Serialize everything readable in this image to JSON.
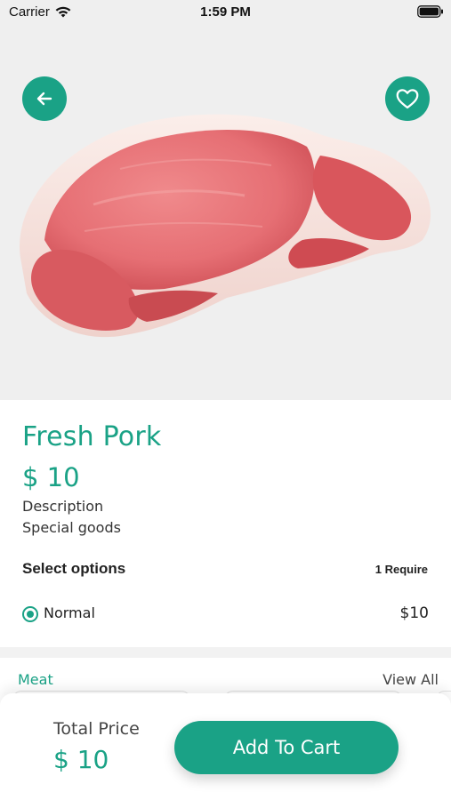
{
  "status_bar": {
    "carrier": "Carrier",
    "time": "1:59 PM",
    "icons": [
      "wifi-icon",
      "battery-icon"
    ]
  },
  "hero": {
    "image": "pork-chop-image",
    "back_icon": "arrow-left-icon",
    "favorite_icon": "heart-outline-icon"
  },
  "product": {
    "title": "Fresh Pork",
    "price": "$ 10",
    "description_label": "Description",
    "description": "Special goods"
  },
  "options": {
    "title": "Select options",
    "requirement": "1 Require",
    "items": [
      {
        "label": "Normal",
        "price": "$10",
        "selected": true
      }
    ]
  },
  "category": {
    "title": "Meat",
    "view_all": "View All"
  },
  "footer": {
    "total_label": "Total Price",
    "total_value": "$ 10",
    "cta_label": "Add To Cart"
  },
  "colors": {
    "accent": "#1aa286",
    "hero_background": "#efefef"
  }
}
